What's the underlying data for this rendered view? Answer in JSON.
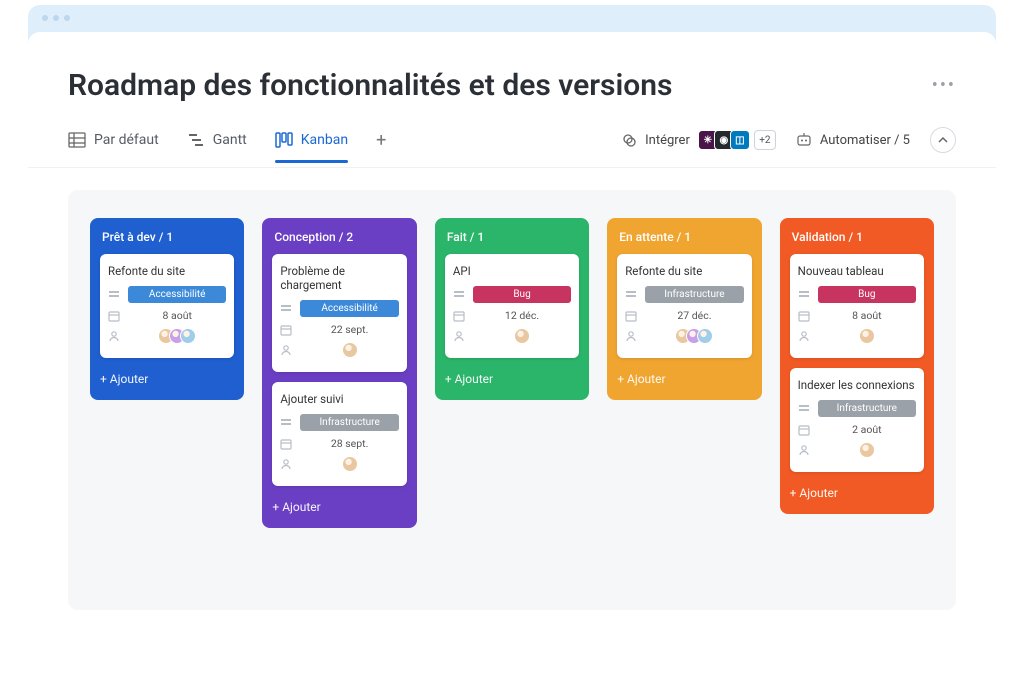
{
  "page": {
    "title": "Roadmap des fonctionnalités et des versions"
  },
  "views": {
    "default": "Par défaut",
    "gantt": "Gantt",
    "kanban": "Kanban"
  },
  "tools": {
    "integrate": "Intégrer",
    "integrate_more": "+2",
    "automate": "Automatiser / 5"
  },
  "tags": {
    "accessibility": {
      "label": "Accessibilité",
      "color": "#3b89d8"
    },
    "infrastructure": {
      "label": "Infrastructure",
      "color": "#9aa1a8"
    },
    "bug": {
      "label": "Bug",
      "color": "#c7345f"
    }
  },
  "columns": [
    {
      "title": "Prêt à dev / 1",
      "color": "#1f5fd0",
      "add": "+ Ajouter",
      "cards": [
        {
          "title": "Refonte du site",
          "tag": "accessibility",
          "date": "8 août",
          "avatars": 3
        }
      ]
    },
    {
      "title": "Conception / 2",
      "color": "#6a3fc4",
      "add": "+ Ajouter",
      "cards": [
        {
          "title": "Problème de chargement",
          "tag": "accessibility",
          "date": "22 sept.",
          "avatars": 1
        },
        {
          "title": "Ajouter suivi",
          "tag": "infrastructure",
          "date": "28 sept.",
          "avatars": 1
        }
      ]
    },
    {
      "title": "Fait / 1",
      "color": "#2bb56a",
      "add": "+ Ajouter",
      "cards": [
        {
          "title": "API",
          "tag": "bug",
          "date": "12 déc.",
          "avatars": 1
        }
      ]
    },
    {
      "title": "En attente / 1",
      "color": "#f0a530",
      "add": "+ Ajouter",
      "cards": [
        {
          "title": "Refonte du site",
          "tag": "infrastructure",
          "date": "27 déc.",
          "avatars": 3
        }
      ]
    },
    {
      "title": "Validation / 1",
      "color": "#f15a24",
      "add": "+ Ajouter",
      "cards": [
        {
          "title": "Nouveau tableau",
          "tag": "bug",
          "date": "8 août",
          "avatars": 1
        },
        {
          "title": "Indexer les connexions",
          "tag": "infrastructure",
          "date": "2 août",
          "avatars": 1
        }
      ]
    }
  ],
  "avatar_colors": [
    "#e9c7a0",
    "#c7a0e9",
    "#a0cde9",
    "#a0e9b2"
  ]
}
